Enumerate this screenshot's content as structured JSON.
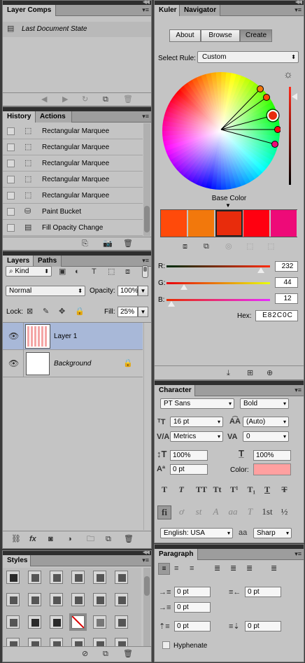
{
  "layer_comps": {
    "tab": "Layer Comps",
    "item": "Last Document State"
  },
  "history": {
    "tabs": [
      "History",
      "Actions"
    ],
    "items": [
      {
        "label": "Rectangular Marquee",
        "icon": "marquee-icon"
      },
      {
        "label": "Rectangular Marquee",
        "icon": "marquee-icon"
      },
      {
        "label": "Rectangular Marquee",
        "icon": "marquee-icon"
      },
      {
        "label": "Rectangular Marquee",
        "icon": "marquee-icon"
      },
      {
        "label": "Rectangular Marquee",
        "icon": "marquee-icon"
      },
      {
        "label": "Paint Bucket",
        "icon": "paint-bucket-icon"
      },
      {
        "label": "Fill Opacity Change",
        "icon": "document-icon"
      }
    ]
  },
  "layers": {
    "tabs": [
      "Layers",
      "Paths"
    ],
    "filter_kind": "Kind",
    "blend_mode": "Normal",
    "opacity_label": "Opacity:",
    "opacity_value": "100%",
    "lock_label": "Lock:",
    "fill_label": "Fill:",
    "fill_value": "25%",
    "items": [
      {
        "name": "Layer 1",
        "selected": true
      },
      {
        "name": "Background",
        "selected": false,
        "locked": true
      }
    ]
  },
  "styles": {
    "tab": "Styles"
  },
  "kuler": {
    "tabs": [
      "Kuler",
      "Navigator"
    ],
    "buttons": [
      "About",
      "Browse",
      "Create"
    ],
    "active_button": "Create",
    "select_rule_label": "Select Rule:",
    "select_rule_value": "Custom",
    "base_color_label": "Base Color",
    "swatches": [
      "#FF4A0A",
      "#F2780C",
      "#E82C0C",
      "#FF0010",
      "#EE0A78"
    ],
    "rgb": [
      {
        "label": "R:",
        "value": "232",
        "fraction": 0.91
      },
      {
        "label": "G:",
        "value": "44",
        "fraction": 0.17
      },
      {
        "label": "B:",
        "value": "12",
        "fraction": 0.05
      }
    ],
    "hex_label": "Hex:",
    "hex_value": "E82C0C"
  },
  "character": {
    "tab": "Character",
    "font_family": "PT Sans",
    "font_style": "Bold",
    "font_size": "16 pt",
    "leading": "(Auto)",
    "kerning": "Metrics",
    "tracking": "0",
    "vertical_scale": "100%",
    "horizontal_scale": "100%",
    "baseline_shift": "0 pt",
    "color_label": "Color:",
    "text_color": "#FFA0A0",
    "style_buttons": [
      "T",
      "T",
      "TT",
      "Tt",
      "T¹",
      "T₁",
      "T",
      "T"
    ],
    "language": "English: USA",
    "aa_label": "aa",
    "antialias": "Sharp",
    "ot_buttons": [
      "fi",
      "ơ",
      "st",
      "A",
      "aa",
      "T",
      "1st",
      "½"
    ]
  },
  "paragraph": {
    "tab": "Paragraph",
    "indent_left": "0 pt",
    "indent_right": "0 pt",
    "indent_first": "0 pt",
    "space_before": "0 pt",
    "space_after": "0 pt",
    "hyphenate": "Hyphenate"
  }
}
